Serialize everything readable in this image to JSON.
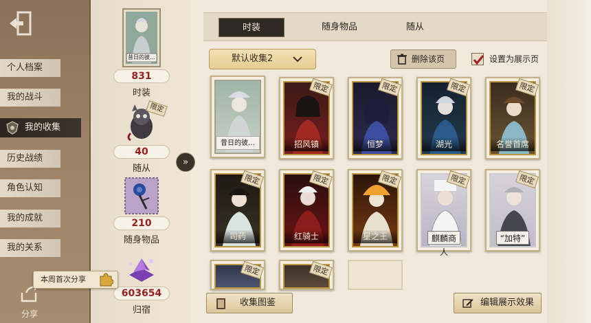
{
  "nav": {
    "items": [
      {
        "label": "个人档案"
      },
      {
        "label": "我的战斗"
      },
      {
        "label": "我的收集"
      },
      {
        "label": "历史战绩"
      },
      {
        "label": "角色认知"
      },
      {
        "label": "我的成就"
      },
      {
        "label": "我的关系"
      }
    ],
    "active_index": 2,
    "share_tip": "本周首次分享",
    "share_label": "分享"
  },
  "stats": [
    {
      "count": "831",
      "label": "时装",
      "thumb_caption": "昔日的彼…"
    },
    {
      "count": "40",
      "label": "随从",
      "ribbon": "限定"
    },
    {
      "count": "210",
      "label": "随身物品"
    },
    {
      "count": "603654",
      "label": "归宿"
    }
  ],
  "tabs": [
    {
      "label": "时装"
    },
    {
      "label": "随身物品"
    },
    {
      "label": "随从"
    }
  ],
  "active_tab": 0,
  "collection_select": {
    "value": "默认收集2"
  },
  "delete_button": "删除该页",
  "showcase_toggle": {
    "label": "设置为展示页",
    "checked": true
  },
  "cards": [
    {
      "name": "昔日的彼…",
      "ribbon": "",
      "frame": "featured"
    },
    {
      "name": "招风镇",
      "ribbon": "限定",
      "frame": "gold"
    },
    {
      "name": "恒梦",
      "ribbon": "限定",
      "frame": "gold"
    },
    {
      "name": "湖光",
      "ribbon": "限定",
      "frame": "gold"
    },
    {
      "name": "名誉首席",
      "ribbon": "限定",
      "frame": "gold"
    },
    {
      "name": "司药",
      "ribbon": "限定",
      "frame": "gold"
    },
    {
      "name": "红骑士",
      "ribbon": "限定",
      "frame": "gold"
    },
    {
      "name": "星之王",
      "ribbon": "限定",
      "frame": "gold"
    },
    {
      "name": "麒麟商人",
      "ribbon": "限定",
      "frame": "white"
    },
    {
      "name": "“加特”",
      "ribbon": "限定",
      "frame": "white"
    },
    {
      "name": "",
      "ribbon": "限定",
      "frame": "gold"
    },
    {
      "name": "",
      "ribbon": "限定",
      "frame": "gold"
    }
  ],
  "bottom": {
    "gallery_button": "收集图鉴",
    "edit_button": "编辑展示效果"
  },
  "colors": {
    "accent_dark": "#2f2924",
    "count_red": "#9a2020",
    "gold_frame": "#b8953e",
    "panel_brown": "#9c8266"
  }
}
